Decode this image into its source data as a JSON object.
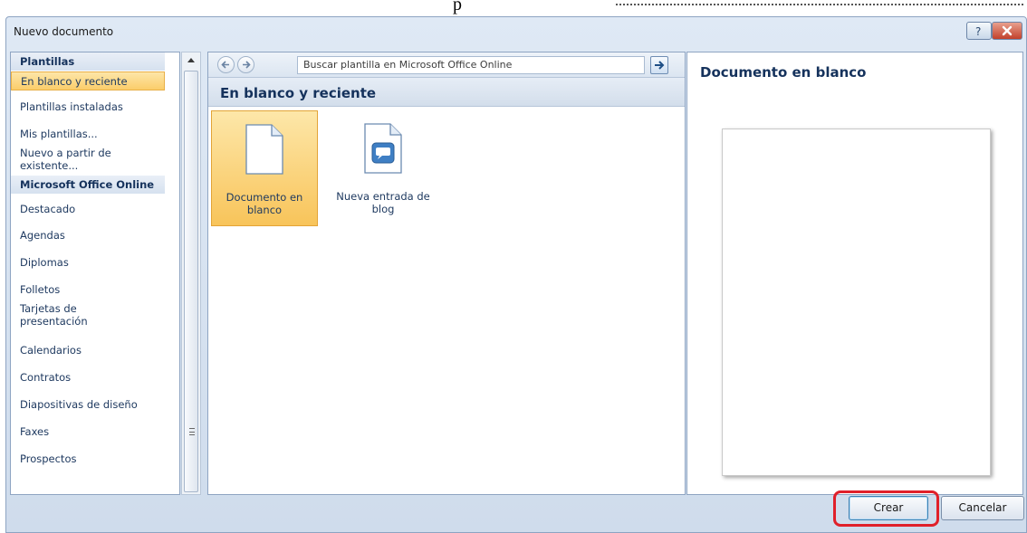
{
  "window": {
    "title": "Nuevo documento"
  },
  "background_fragment": "p",
  "sidebar": {
    "sections": [
      {
        "header": "Plantillas",
        "items": [
          {
            "label": "En blanco y reciente",
            "selected": true
          },
          {
            "label": "Plantillas instaladas"
          },
          {
            "label": "Mis plantillas..."
          },
          {
            "label": "Nuevo a partir de existente..."
          }
        ]
      },
      {
        "header": "Microsoft Office Online",
        "items": [
          {
            "label": "Destacado"
          },
          {
            "label": "Agendas"
          },
          {
            "label": "Diplomas"
          },
          {
            "label": "Folletos"
          },
          {
            "label": "Tarjetas de presentación"
          },
          {
            "label": "Calendarios"
          },
          {
            "label": "Contratos"
          },
          {
            "label": "Diapositivas de diseño"
          },
          {
            "label": "Faxes"
          },
          {
            "label": "Prospectos"
          }
        ]
      }
    ]
  },
  "toolbar": {
    "back_icon": "arrow-left-icon",
    "forward_icon": "arrow-right-icon",
    "search_placeholder": "Buscar plantilla en Microsoft Office Online",
    "go_icon": "go-arrow-icon"
  },
  "main": {
    "section_title": "En blanco y reciente",
    "templates": [
      {
        "label": "Documento en blanco",
        "icon": "blank-document-icon",
        "selected": true
      },
      {
        "label": "Nueva entrada de blog",
        "icon": "blog-post-icon",
        "selected": false
      }
    ]
  },
  "preview": {
    "title": "Documento en blanco"
  },
  "buttons": {
    "create_label": "Crear",
    "cancel_label": "Cancelar"
  },
  "colors": {
    "selection": "#fbcd6a",
    "highlight_ring": "#e0202a",
    "header_text": "#15325c"
  }
}
